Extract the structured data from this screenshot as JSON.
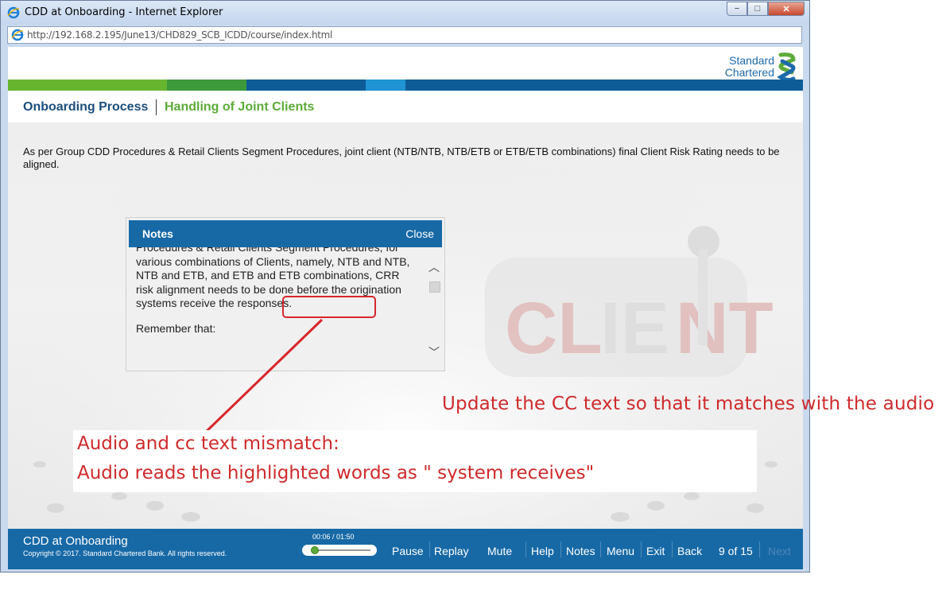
{
  "window": {
    "title": "CDD at Onboarding - Internet Explorer",
    "url": "http://192.168.2.195/June13/CHD829_SCB_ICDD/course/index.html",
    "minimize": "−",
    "maximize": "□",
    "close": "✕"
  },
  "logo": {
    "line1": "Standard",
    "line2": "Chartered"
  },
  "nav": {
    "title": "Onboarding Process",
    "subtitle": "Handling of Joint Clients"
  },
  "body_text": "As per Group CDD Procedures & Retail Clients Segment Procedures, joint client (NTB/NTB, NTB/ETB or ETB/ETB combinations) final Client Risk Rating needs to be aligned.",
  "notes": {
    "title": "Notes",
    "close": "Close",
    "paragraph1": "Procedures & Retail Clients Segment Procedures, for various combinations of Clients, namely, NTB and NTB, NTB and ETB, and ETB and ETB combinations, CRR risk alignment needs to be done before the origination systems receive the responses.",
    "paragraph2": "Remember that:",
    "scroll_up": "︿",
    "scroll_down": "﹀"
  },
  "footer": {
    "title": "CDD at Onboarding",
    "copyright": "Copyright © 2017. Standard Chartered Bank. All rights reserved.",
    "time": "00:06 / 01:50",
    "progress": 0.055,
    "controls": {
      "pause": "Pause",
      "replay": "Replay",
      "mute": "Mute",
      "help": "Help",
      "notes": "Notes",
      "menu": "Menu",
      "exit": "Exit",
      "back": "Back",
      "page": "9 of 15",
      "next": "Next"
    }
  },
  "annotations": {
    "right": "Update the CC text so that it matches with the audio",
    "line1": "Audio and cc text mismatch:",
    "line2": "Audio reads the highlighted words as \" system receives\""
  },
  "colors": {
    "brand_blue": "#1769a6",
    "brand_green": "#5cab39",
    "annotation_red": "#cf2a2c"
  }
}
